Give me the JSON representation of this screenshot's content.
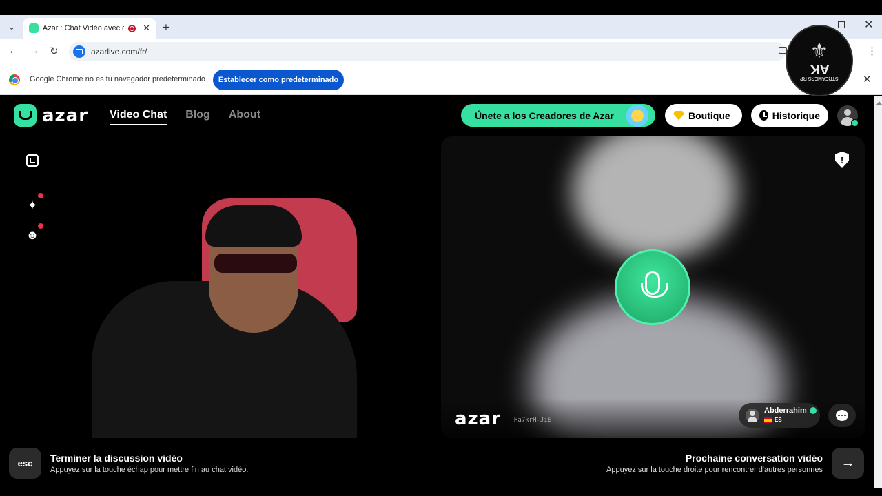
{
  "browser": {
    "tab_title": "Azar : Chat Vidéo avec de n",
    "url": "azarlive.com/fr/",
    "info_text": "Google Chrome no es tu navegador predeterminado",
    "info_button": "Establecer como predeterminado"
  },
  "watermark": {
    "brand": "AK",
    "sub": "STREAMERS RP"
  },
  "header": {
    "logo": "azar",
    "nav": [
      {
        "label": "Video Chat",
        "active": true
      },
      {
        "label": "Blog",
        "active": false
      },
      {
        "label": "About",
        "active": false
      }
    ],
    "creators_button": "Únete a los Creadores de Azar",
    "boutique": "Boutique",
    "historique": "Historique"
  },
  "video_right": {
    "logo": "azar",
    "code": "Ha7krH-JiE",
    "partner_name": "Abderrahim",
    "partner_lang": "ES"
  },
  "footer": {
    "esc_label": "esc",
    "end_title": "Terminer la discussion vidéo",
    "end_sub": "Appuyez sur la touche échap pour mettre fin au chat vidéo.",
    "next_title": "Prochaine conversation vidéo",
    "next_sub": "Appuyez sur la touche droite pour rencontrer d'autres personnes"
  },
  "colors": {
    "brand": "#35e0a1",
    "chrome_blue": "#0b57d0",
    "alert": "#e8334a"
  }
}
